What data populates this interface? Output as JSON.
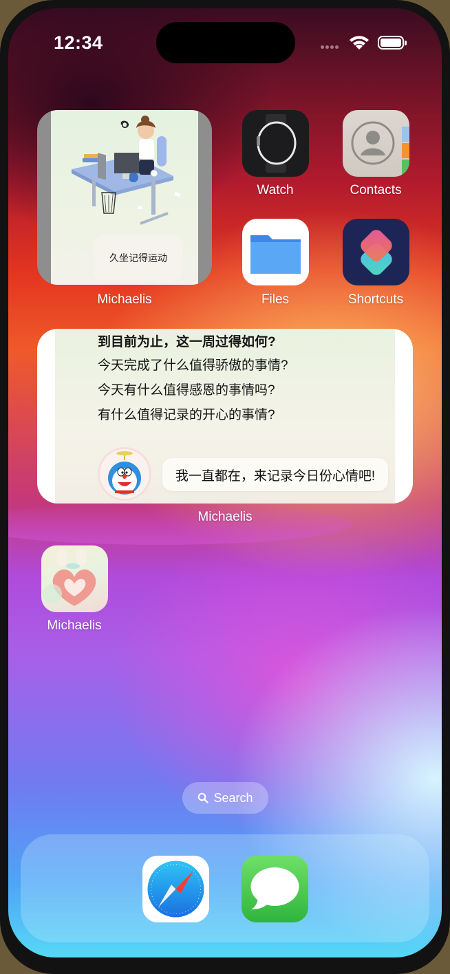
{
  "status": {
    "time": "12:34"
  },
  "widgets": {
    "small": {
      "caption": "久坐记得运动",
      "label": "Michaelis"
    },
    "wide": {
      "questions": [
        "到目前为止，这一周过得如何?",
        "今天完成了什么值得骄傲的事情?",
        "今天有什么值得感恩的事情吗?",
        "有什么值得记录的开心的事情?"
      ],
      "bubble": "我一直都在，来记录今日份心情吧!",
      "label": "Michaelis"
    }
  },
  "apps": [
    {
      "label": "Watch",
      "icon": "watch-icon"
    },
    {
      "label": "Contacts",
      "icon": "contacts-icon"
    },
    {
      "label": "Files",
      "icon": "files-icon"
    },
    {
      "label": "Shortcuts",
      "icon": "shortcuts-icon"
    },
    {
      "label": "Michaelis",
      "icon": "michaelis-app-icon"
    }
  ],
  "search": {
    "label": "Search"
  },
  "dock": [
    {
      "app": "Safari",
      "icon": "safari-icon"
    },
    {
      "app": "Messages",
      "icon": "messages-icon"
    }
  ],
  "colors": {
    "text": "#ffffff",
    "widget_text": "#141414",
    "dock_bg": "rgba(210,240,255,0.28)"
  }
}
